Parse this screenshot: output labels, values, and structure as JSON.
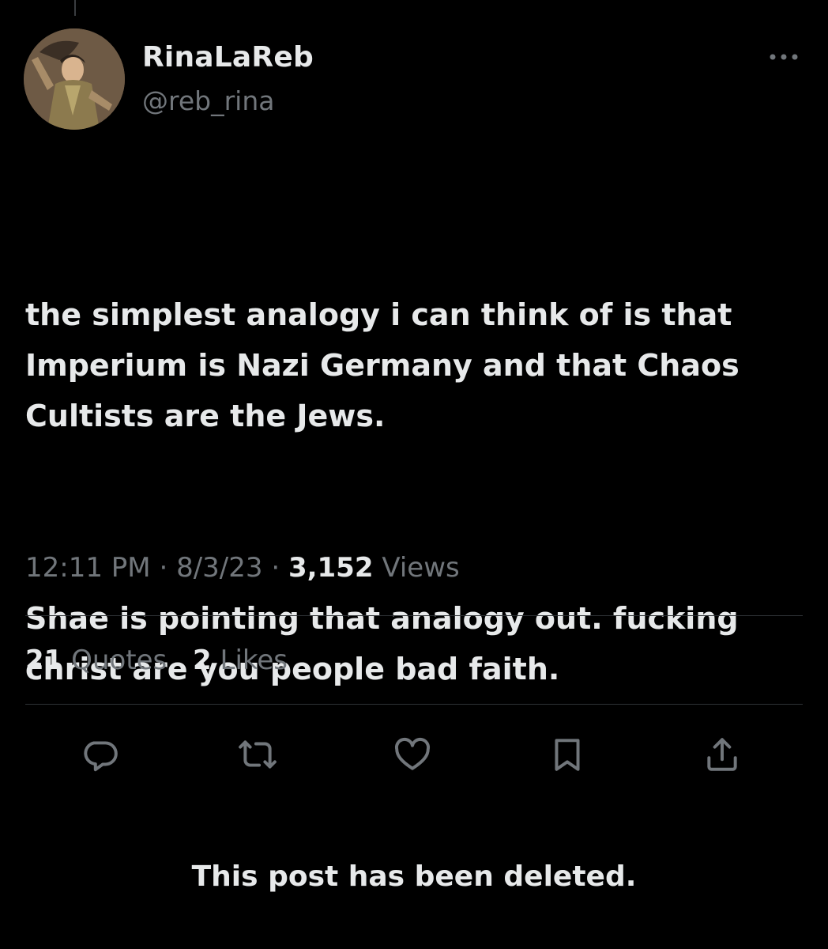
{
  "user": {
    "display_name": "RinaLaReb",
    "handle": "@reb_rina"
  },
  "tweet": {
    "paragraphs": [
      "the simplest analogy i can think of is that Imperium is Nazi Germany and that Chaos Cultists are the Jews.",
      "Shae is pointing that analogy out. fucking christ are you people bad faith."
    ]
  },
  "meta": {
    "time": "12:11 PM",
    "separator": "·",
    "date": "8/3/23",
    "views_count": "3,152",
    "views_label": "Views"
  },
  "stats": {
    "quotes_count": "21",
    "quotes_label": "Quotes",
    "likes_count": "2",
    "likes_label": "Likes"
  },
  "actions": {
    "reply_icon": "reply-icon",
    "retweet_icon": "retweet-icon",
    "like_icon": "heart-icon",
    "bookmark_icon": "bookmark-icon",
    "share_icon": "share-icon"
  },
  "notice": {
    "deleted_text": "This post has been deleted."
  },
  "colors": {
    "background": "#000000",
    "primary_text": "#e7e9ea",
    "secondary_text": "#71767b",
    "divider": "#2f3336"
  }
}
